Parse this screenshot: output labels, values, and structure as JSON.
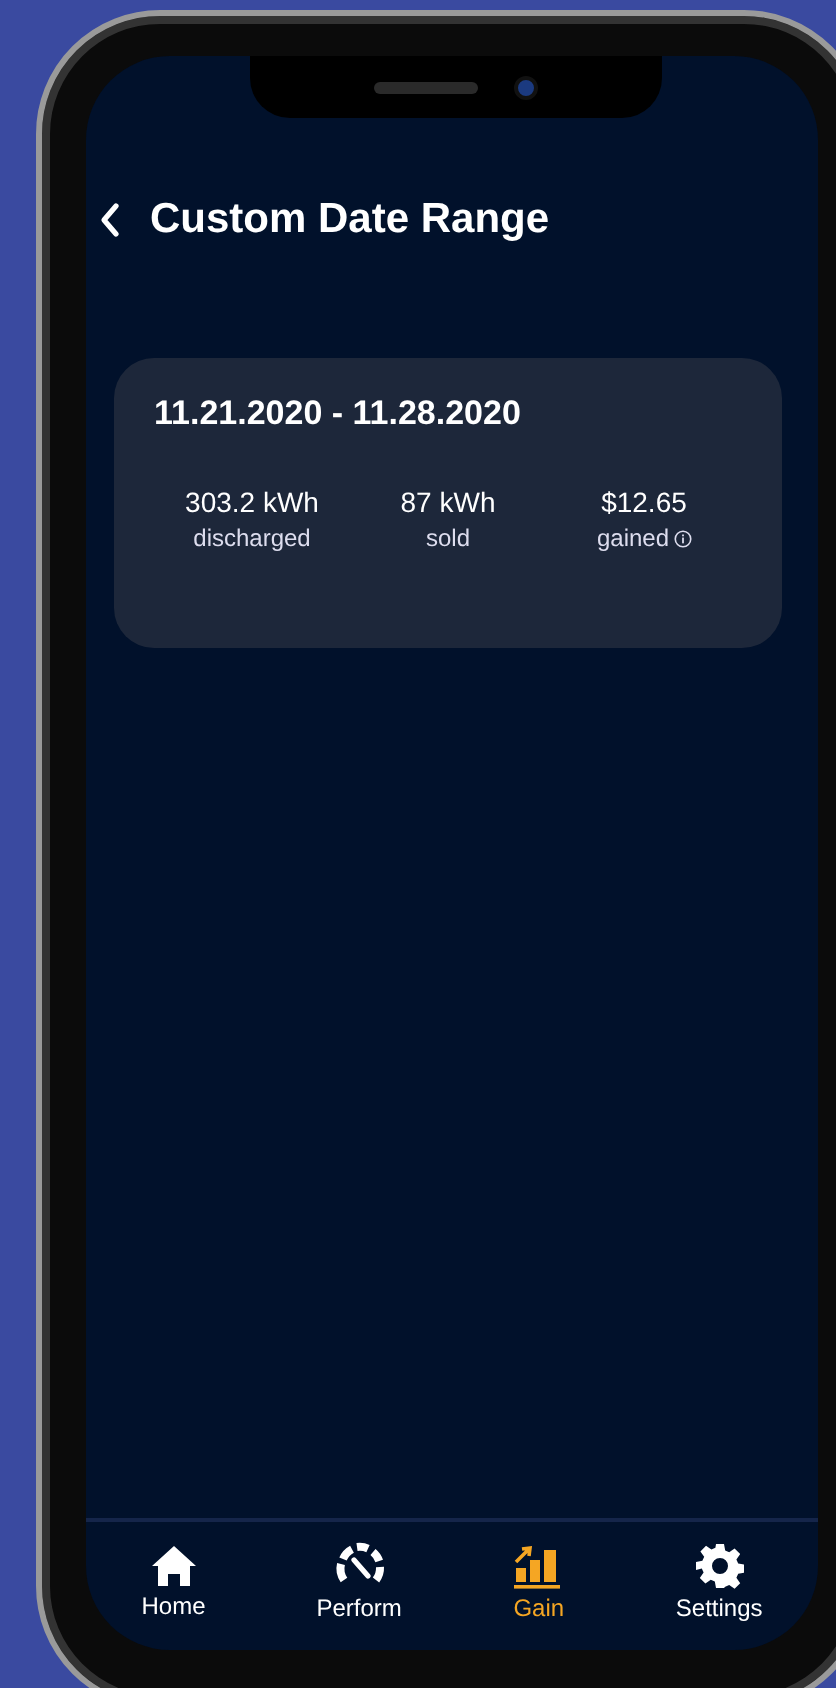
{
  "header": {
    "title": "Custom Date Range"
  },
  "summary": {
    "date_range": "11.21.2020 - 11.28.2020",
    "stats": [
      {
        "value": "303.2 kWh",
        "label": "discharged",
        "info": false
      },
      {
        "value": "87 kWh",
        "label": "sold",
        "info": false
      },
      {
        "value": "$12.65",
        "label": "gained",
        "info": true
      }
    ]
  },
  "nav": [
    {
      "kind": "home",
      "label": "Home",
      "selected": false
    },
    {
      "kind": "gauge",
      "label": "Perform",
      "selected": false
    },
    {
      "kind": "chart",
      "label": "Gain",
      "selected": true
    },
    {
      "kind": "gear",
      "label": "Settings",
      "selected": false
    }
  ]
}
